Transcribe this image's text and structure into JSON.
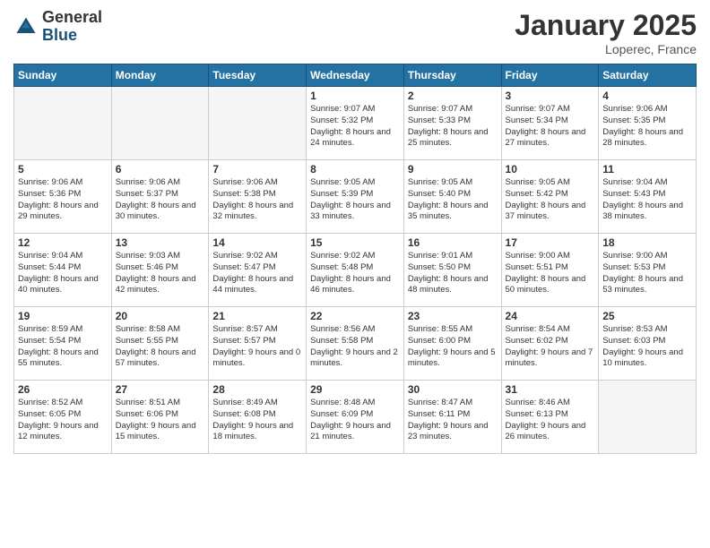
{
  "logo": {
    "general": "General",
    "blue": "Blue"
  },
  "title": "January 2025",
  "location": "Loperec, France",
  "days_of_week": [
    "Sunday",
    "Monday",
    "Tuesday",
    "Wednesday",
    "Thursday",
    "Friday",
    "Saturday"
  ],
  "weeks": [
    [
      {
        "day": "",
        "info": ""
      },
      {
        "day": "",
        "info": ""
      },
      {
        "day": "",
        "info": ""
      },
      {
        "day": "1",
        "info": "Sunrise: 9:07 AM\nSunset: 5:32 PM\nDaylight: 8 hours and 24 minutes."
      },
      {
        "day": "2",
        "info": "Sunrise: 9:07 AM\nSunset: 5:33 PM\nDaylight: 8 hours and 25 minutes."
      },
      {
        "day": "3",
        "info": "Sunrise: 9:07 AM\nSunset: 5:34 PM\nDaylight: 8 hours and 27 minutes."
      },
      {
        "day": "4",
        "info": "Sunrise: 9:06 AM\nSunset: 5:35 PM\nDaylight: 8 hours and 28 minutes."
      }
    ],
    [
      {
        "day": "5",
        "info": "Sunrise: 9:06 AM\nSunset: 5:36 PM\nDaylight: 8 hours and 29 minutes."
      },
      {
        "day": "6",
        "info": "Sunrise: 9:06 AM\nSunset: 5:37 PM\nDaylight: 8 hours and 30 minutes."
      },
      {
        "day": "7",
        "info": "Sunrise: 9:06 AM\nSunset: 5:38 PM\nDaylight: 8 hours and 32 minutes."
      },
      {
        "day": "8",
        "info": "Sunrise: 9:05 AM\nSunset: 5:39 PM\nDaylight: 8 hours and 33 minutes."
      },
      {
        "day": "9",
        "info": "Sunrise: 9:05 AM\nSunset: 5:40 PM\nDaylight: 8 hours and 35 minutes."
      },
      {
        "day": "10",
        "info": "Sunrise: 9:05 AM\nSunset: 5:42 PM\nDaylight: 8 hours and 37 minutes."
      },
      {
        "day": "11",
        "info": "Sunrise: 9:04 AM\nSunset: 5:43 PM\nDaylight: 8 hours and 38 minutes."
      }
    ],
    [
      {
        "day": "12",
        "info": "Sunrise: 9:04 AM\nSunset: 5:44 PM\nDaylight: 8 hours and 40 minutes."
      },
      {
        "day": "13",
        "info": "Sunrise: 9:03 AM\nSunset: 5:46 PM\nDaylight: 8 hours and 42 minutes."
      },
      {
        "day": "14",
        "info": "Sunrise: 9:02 AM\nSunset: 5:47 PM\nDaylight: 8 hours and 44 minutes."
      },
      {
        "day": "15",
        "info": "Sunrise: 9:02 AM\nSunset: 5:48 PM\nDaylight: 8 hours and 46 minutes."
      },
      {
        "day": "16",
        "info": "Sunrise: 9:01 AM\nSunset: 5:50 PM\nDaylight: 8 hours and 48 minutes."
      },
      {
        "day": "17",
        "info": "Sunrise: 9:00 AM\nSunset: 5:51 PM\nDaylight: 8 hours and 50 minutes."
      },
      {
        "day": "18",
        "info": "Sunrise: 9:00 AM\nSunset: 5:53 PM\nDaylight: 8 hours and 53 minutes."
      }
    ],
    [
      {
        "day": "19",
        "info": "Sunrise: 8:59 AM\nSunset: 5:54 PM\nDaylight: 8 hours and 55 minutes."
      },
      {
        "day": "20",
        "info": "Sunrise: 8:58 AM\nSunset: 5:55 PM\nDaylight: 8 hours and 57 minutes."
      },
      {
        "day": "21",
        "info": "Sunrise: 8:57 AM\nSunset: 5:57 PM\nDaylight: 9 hours and 0 minutes."
      },
      {
        "day": "22",
        "info": "Sunrise: 8:56 AM\nSunset: 5:58 PM\nDaylight: 9 hours and 2 minutes."
      },
      {
        "day": "23",
        "info": "Sunrise: 8:55 AM\nSunset: 6:00 PM\nDaylight: 9 hours and 5 minutes."
      },
      {
        "day": "24",
        "info": "Sunrise: 8:54 AM\nSunset: 6:02 PM\nDaylight: 9 hours and 7 minutes."
      },
      {
        "day": "25",
        "info": "Sunrise: 8:53 AM\nSunset: 6:03 PM\nDaylight: 9 hours and 10 minutes."
      }
    ],
    [
      {
        "day": "26",
        "info": "Sunrise: 8:52 AM\nSunset: 6:05 PM\nDaylight: 9 hours and 12 minutes."
      },
      {
        "day": "27",
        "info": "Sunrise: 8:51 AM\nSunset: 6:06 PM\nDaylight: 9 hours and 15 minutes."
      },
      {
        "day": "28",
        "info": "Sunrise: 8:49 AM\nSunset: 6:08 PM\nDaylight: 9 hours and 18 minutes."
      },
      {
        "day": "29",
        "info": "Sunrise: 8:48 AM\nSunset: 6:09 PM\nDaylight: 9 hours and 21 minutes."
      },
      {
        "day": "30",
        "info": "Sunrise: 8:47 AM\nSunset: 6:11 PM\nDaylight: 9 hours and 23 minutes."
      },
      {
        "day": "31",
        "info": "Sunrise: 8:46 AM\nSunset: 6:13 PM\nDaylight: 9 hours and 26 minutes."
      },
      {
        "day": "",
        "info": ""
      }
    ]
  ]
}
